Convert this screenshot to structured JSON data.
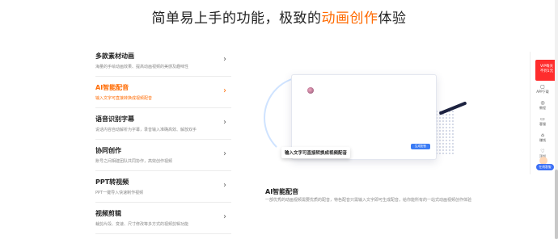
{
  "headline": {
    "prefix": "简单易上手的功能，极致的",
    "accent": "动画创作",
    "suffix": "体验",
    "accent_color": "#ff6a00"
  },
  "features": [
    {
      "title": "多款素材动画",
      "desc": "海量的手绘动画效果、提高动画视频的美感及趣味性",
      "active": false
    },
    {
      "title": "AI智能配音",
      "desc": "输入文字可直接转换成视频配音",
      "active": true
    },
    {
      "title": "语音识别字幕",
      "desc": "说话内容自动解析为字幕，录音输入准确高效、解放双手",
      "active": false
    },
    {
      "title": "协同创作",
      "desc": "账号之间相建团队共同协作，高效创作视频",
      "active": false
    },
    {
      "title": "PPT转视频",
      "desc": "PPT一键导入快速制作视频",
      "active": false
    },
    {
      "title": "视频剪辑",
      "desc": "裁剪片段、变速、尺寸修改等多方式的视频剪辑功能",
      "active": false
    }
  ],
  "preview": {
    "caption": "输入文字可直接转换成视频配音",
    "button_label": "生成配音"
  },
  "description": {
    "title": "AI智能配音",
    "text": "一部优秀的动画视频需要优质的配音，特色配音只需输入文字即可生成配音，给你能所有的一站式动画视频创作体验"
  },
  "sidebar": {
    "vip_line1": "VIP每天",
    "vip_line2": "不到1元",
    "items": [
      {
        "icon": "▢",
        "label": "APP下载"
      },
      {
        "icon": "◎",
        "label": "教程"
      },
      {
        "icon": "▭",
        "label": "客服"
      },
      {
        "icon": "⌂",
        "label": "赚钱"
      },
      {
        "icon": "♡",
        "label": "顶部"
      }
    ],
    "service_label": "在线客服"
  }
}
